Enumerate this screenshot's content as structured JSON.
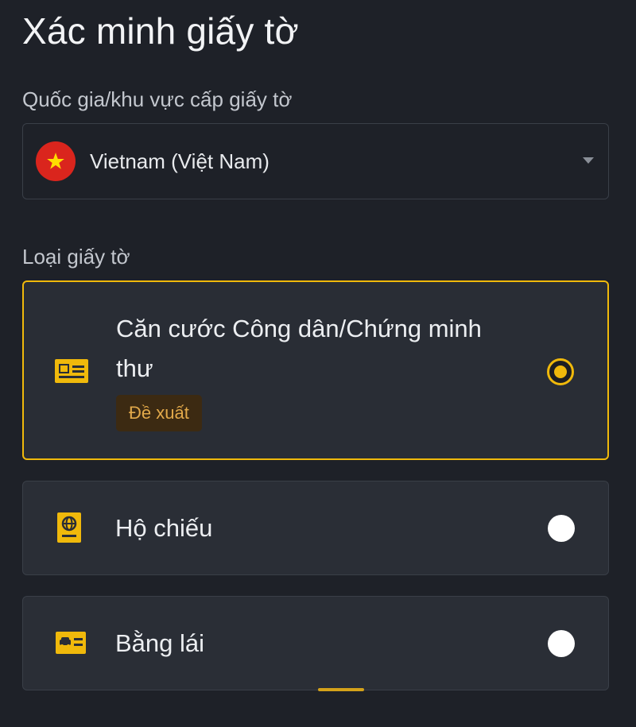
{
  "page": {
    "title": "Xác minh giấy tờ"
  },
  "country": {
    "label": "Quốc gia/khu vực cấp giấy tờ",
    "value": "Vietnam (Việt Nam)",
    "flag_icon": "vietnam-flag-icon"
  },
  "document_type": {
    "label": "Loại giấy tờ",
    "options": [
      {
        "title_line1": "Căn cước Công dân/Chứng minh",
        "title_line2": "thư",
        "badge": "Đề xuất",
        "icon": "id-card-icon",
        "selected": true
      },
      {
        "title": "Hộ chiếu",
        "icon": "passport-icon",
        "selected": false
      },
      {
        "title": "Bằng lái",
        "icon": "driver-license-icon",
        "selected": false
      }
    ]
  },
  "colors": {
    "background": "#1e2128",
    "card": "#2a2e36",
    "accent": "#f0b90b",
    "flag_red": "#da251d",
    "badge_bg": "#3c2a12",
    "badge_text": "#e2a94a"
  }
}
